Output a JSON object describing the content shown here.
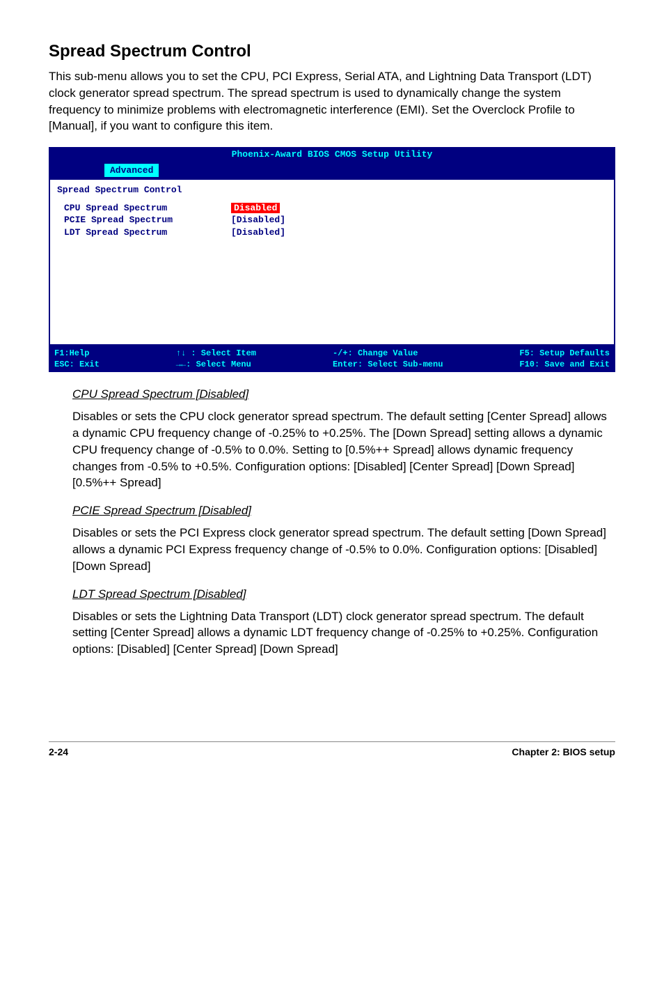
{
  "section_title": "Spread Spectrum Control",
  "intro": "This sub-menu allows you to set the CPU, PCI Express, Serial ATA, and Lightning Data Transport (LDT) clock generator spread spectrum. The spread spectrum is used to dynamically change the system frequency to minimize problems with  electromagnetic interference (EMI). Set the Overclock Profile to [Manual], if you want to configure this item.",
  "bios": {
    "title": "Phoenix-Award BIOS CMOS Setup Utility",
    "menu_tab": "Advanced",
    "sub_title": "Spread Spectrum Control",
    "rows": [
      {
        "label": "CPU Spread Spectrum",
        "value": "Disabled",
        "highlight": true
      },
      {
        "label": "PCIE Spread Spectrum",
        "value": "[Disabled]",
        "highlight": false
      },
      {
        "label": "LDT Spread Spectrum",
        "value": "[Disabled]",
        "highlight": false
      }
    ],
    "help": {
      "col1a": "F1:Help",
      "col1b": "ESC: Exit",
      "col2a": "↑↓ : Select Item",
      "col2b": "→←: Select Menu",
      "col3a": "-/+: Change Value",
      "col3b": "Enter: Select Sub-menu",
      "col4a": "F5: Setup Defaults",
      "col4b": "F10: Save and Exit"
    }
  },
  "items": [
    {
      "heading": "CPU Spread Spectrum [Disabled]",
      "body": "Disables or sets the CPU clock generator spread spectrum. The default setting [Center Spread] allows a dynamic CPU frequency change of -0.25% to +0.25%. The [Down Spread] setting allows a dynamic CPU frequency change of -0.5% to 0.0%. Setting to [0.5%++ Spread] allows dynamic frequency changes from -0.5% to +0.5%. Configuration options: [Disabled] [Center Spread] [Down Spread] [0.5%++ Spread]"
    },
    {
      "heading": "PCIE Spread Spectrum [Disabled]",
      "body": "Disables or sets the PCI Express clock generator spread spectrum. The default setting [Down Spread] allows a dynamic PCI Express frequency change of -0.5% to 0.0%. Configuration options: [Disabled] [Down Spread]"
    },
    {
      "heading": "LDT Spread Spectrum [Disabled]",
      "body": "Disables or sets the Lightning Data Transport (LDT) clock generator spread spectrum. The default setting [Center Spread] allows a dynamic LDT frequency change of -0.25% to +0.25%. Configuration options: [Disabled] [Center Spread] [Down Spread]"
    }
  ],
  "footer": {
    "left": "2-24",
    "right": "Chapter 2: BIOS setup"
  }
}
